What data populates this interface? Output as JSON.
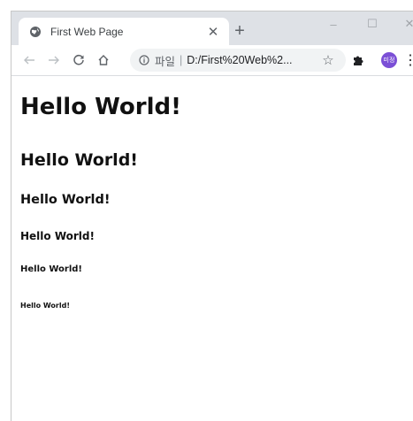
{
  "browser": {
    "tab": {
      "title": "First Web Page",
      "favicon_icon": "globe-icon",
      "close_icon": "close-icon"
    },
    "new_tab_label": "+",
    "window_controls": {
      "minimize": "–",
      "maximize": "☐",
      "close": "✕"
    },
    "toolbar": {
      "back_icon": "arrow-left-icon",
      "forward_icon": "arrow-right-icon",
      "reload_icon": "reload-icon",
      "home_icon": "home-icon",
      "bookmark_icon": "star-icon",
      "extensions_icon": "puzzle-icon",
      "menu_icon": "kebab-menu-icon"
    },
    "address_bar": {
      "scheme_label": "파일",
      "separator": "|",
      "url": "D:/First%20Web%2..."
    },
    "profile": {
      "initials": "미정",
      "color": "#7b4fd6"
    }
  },
  "page": {
    "headings": [
      "Hello World!",
      "Hello World!",
      "Hello World!",
      "Hello World!",
      "Hello World!",
      "Hello World!"
    ]
  }
}
